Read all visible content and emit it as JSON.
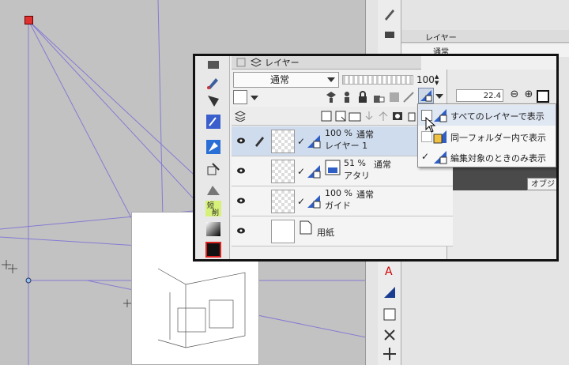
{
  "background_panel": {
    "layer_tab": "レイヤー",
    "blend_mode": "通常"
  },
  "layer_panel": {
    "tab_label": "レイヤー",
    "blend_mode": "通常",
    "opacity": "100",
    "zoom_value": "22.4",
    "object_button": "オブジ"
  },
  "layers": [
    {
      "percent": "100 %",
      "mode": "通常",
      "name": "レイヤー 1",
      "selected": true
    },
    {
      "percent": "51 %",
      "mode": "通常",
      "name": "アタリ",
      "selected": false
    },
    {
      "percent": "100 %",
      "mode": "通常",
      "name": "ガイド",
      "selected": false
    },
    {
      "percent": "",
      "mode": "",
      "name": "用紙",
      "selected": false
    }
  ],
  "popup_menu": {
    "items": [
      {
        "label": "すべてのレイヤーで表示",
        "checked": false
      },
      {
        "label": "同一フォルダー内で表示",
        "checked": false
      },
      {
        "label": "編集対象のときのみ表示",
        "checked": true
      }
    ]
  },
  "colors": {
    "selection": "#cfdcee",
    "menu_hover": "#dfe7f3",
    "ruler_lines": "#7b6fd6"
  }
}
